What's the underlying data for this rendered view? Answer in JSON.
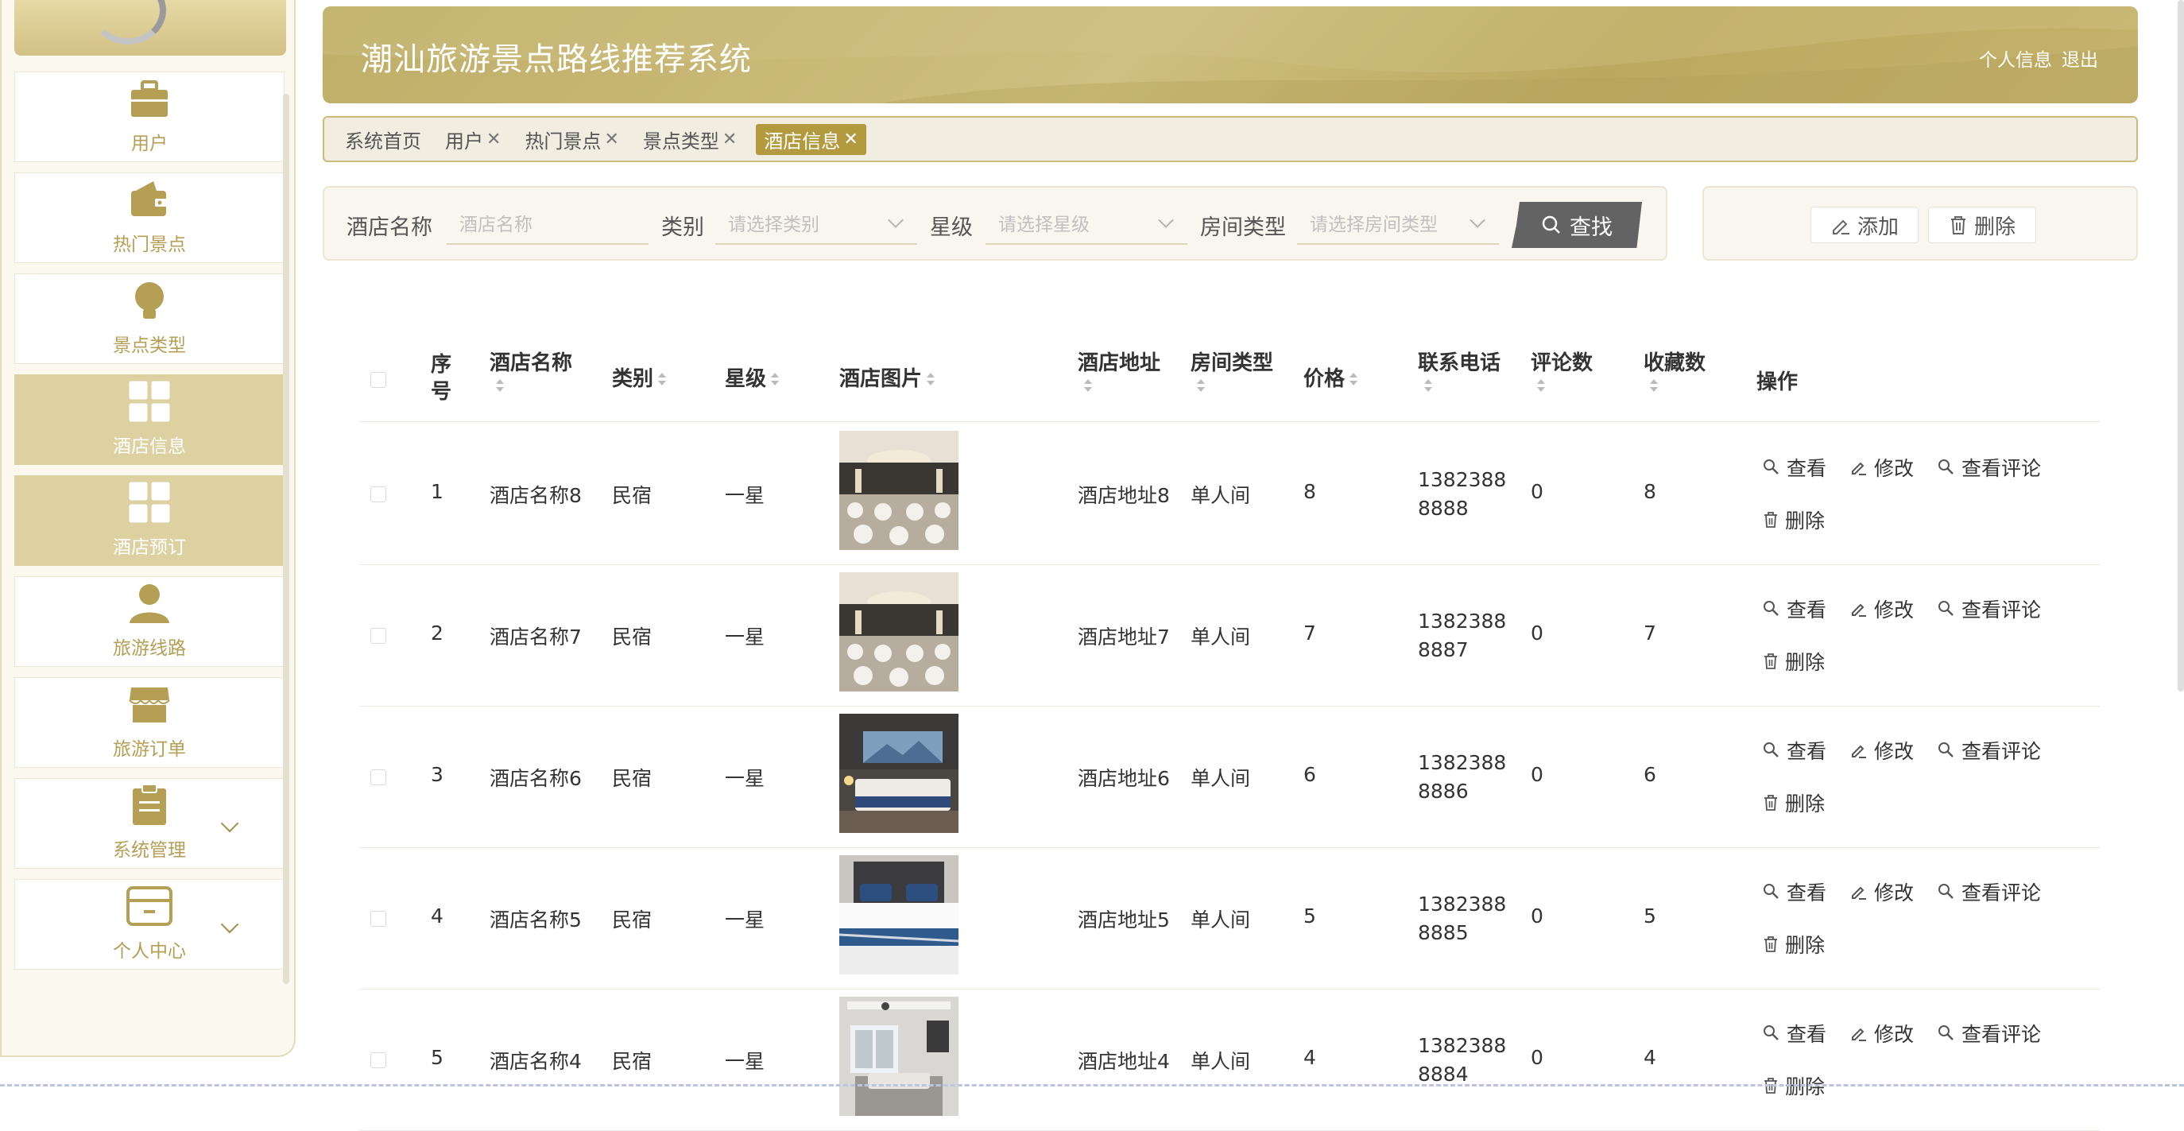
{
  "sidebar": {
    "items": [
      {
        "label": "用户",
        "icon": "briefcase-icon",
        "active": false,
        "expandable": false
      },
      {
        "label": "热门景点",
        "icon": "wallet-icon",
        "active": false,
        "expandable": false
      },
      {
        "label": "景点类型",
        "icon": "lightbulb-icon",
        "active": false,
        "expandable": false
      },
      {
        "label": "酒店信息",
        "icon": "grid-icon",
        "active": true,
        "expandable": false
      },
      {
        "label": "酒店预订",
        "icon": "grid-icon",
        "active": true,
        "expandable": false
      },
      {
        "label": "旅游线路",
        "icon": "user-icon",
        "active": false,
        "expandable": false
      },
      {
        "label": "旅游订单",
        "icon": "shop-icon",
        "active": false,
        "expandable": false
      },
      {
        "label": "系统管理",
        "icon": "clipboard-icon",
        "active": false,
        "expandable": true
      },
      {
        "label": "个人中心",
        "icon": "card-icon",
        "active": false,
        "expandable": true
      }
    ]
  },
  "header": {
    "title": "潮汕旅游景点路线推荐系统",
    "profile_link": "个人信息",
    "logout_link": "退出"
  },
  "tabs": [
    {
      "label": "系统首页",
      "closable": false,
      "active": false
    },
    {
      "label": "用户",
      "closable": true,
      "active": false
    },
    {
      "label": "热门景点",
      "closable": true,
      "active": false
    },
    {
      "label": "景点类型",
      "closable": true,
      "active": false
    },
    {
      "label": "酒店信息",
      "closable": true,
      "active": true
    }
  ],
  "tab_close_symbol": "✕",
  "search": {
    "name_label": "酒店名称",
    "name_placeholder": "酒店名称",
    "category_label": "类别",
    "category_placeholder": "请选择类别",
    "star_label": "星级",
    "star_placeholder": "请选择星级",
    "room_label": "房间类型",
    "room_placeholder": "请选择房间类型",
    "search_button": "查找"
  },
  "actions": {
    "add_button": "添加",
    "delete_button": "删除"
  },
  "table": {
    "headers": {
      "index": "序号",
      "name": "酒店名称",
      "category": "类别",
      "star": "星级",
      "image": "酒店图片",
      "address": "酒店地址",
      "room_type": "房间类型",
      "price": "价格",
      "phone": "联系电话",
      "comments": "评论数",
      "favorites": "收藏数",
      "ops": "操作"
    },
    "ops": {
      "view": "查看",
      "edit": "修改",
      "view_comments": "查看评论",
      "delete": "删除"
    },
    "rows": [
      {
        "index": "1",
        "name": "酒店名称8",
        "category": "民宿",
        "star": "一星",
        "image": "banquet-hall",
        "address": "酒店地址8",
        "room_type": "单人间",
        "price": "8",
        "phone_line1": "1382388",
        "phone_line2": "8888",
        "comments": "0",
        "favorites": "8"
      },
      {
        "index": "2",
        "name": "酒店名称7",
        "category": "民宿",
        "star": "一星",
        "image": "banquet-hall",
        "address": "酒店地址7",
        "room_type": "单人间",
        "price": "7",
        "phone_line1": "1382388",
        "phone_line2": "8887",
        "comments": "0",
        "favorites": "7"
      },
      {
        "index": "3",
        "name": "酒店名称6",
        "category": "民宿",
        "star": "一星",
        "image": "dark-bedroom",
        "address": "酒店地址6",
        "room_type": "单人间",
        "price": "6",
        "phone_line1": "1382388",
        "phone_line2": "8886",
        "comments": "0",
        "favorites": "6"
      },
      {
        "index": "4",
        "name": "酒店名称5",
        "category": "民宿",
        "star": "一星",
        "image": "white-bed",
        "address": "酒店地址5",
        "room_type": "单人间",
        "price": "5",
        "phone_line1": "1382388",
        "phone_line2": "8885",
        "comments": "0",
        "favorites": "5"
      },
      {
        "index": "5",
        "name": "酒店名称4",
        "category": "民宿",
        "star": "一星",
        "image": "bright-room",
        "address": "酒店地址4",
        "room_type": "单人间",
        "price": "4",
        "phone_line1": "1382388",
        "phone_line2": "8884",
        "comments": "0",
        "favorites": "4"
      }
    ]
  },
  "colors": {
    "accent": "#bfae67",
    "active_nav": "#ddd1a1",
    "active_tab": "#b39a3f",
    "search_button": "#636363"
  }
}
